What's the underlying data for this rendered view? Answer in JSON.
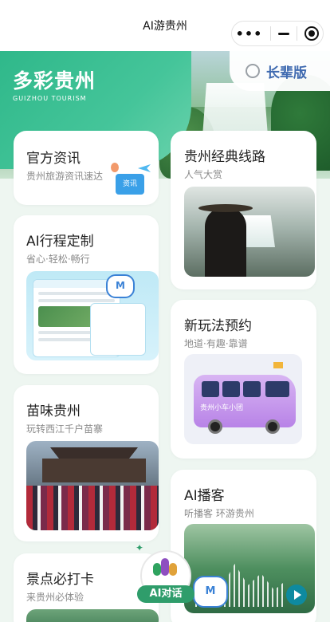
{
  "nav": {
    "title": "AI游贵州"
  },
  "brand": {
    "cn": "多彩贵州",
    "en": "GUIZHOU TOURISM"
  },
  "elder_mode": {
    "label": "长辈版"
  },
  "cards": {
    "news": {
      "title": "官方资讯",
      "subtitle": "贵州旅游资讯速达",
      "badge": "资讯"
    },
    "ai_trip": {
      "title": "AI行程定制",
      "subtitle": "省心·轻松·畅行"
    },
    "miao": {
      "title": "苗味贵州",
      "subtitle": "玩转西江千户苗寨"
    },
    "scenic": {
      "title": "景点必打卡",
      "subtitle": "来贵州必体验"
    },
    "route": {
      "title": "贵州经典线路",
      "subtitle": "人气大赏"
    },
    "new_play": {
      "title": "新玩法预约",
      "subtitle": "地道·有趣·靠谱",
      "bus_text": "贵州小车小团"
    },
    "podcast": {
      "title": "AI播客",
      "subtitle": "听播客 环游贵州"
    }
  },
  "ai_chat": {
    "label": "AI对话"
  }
}
